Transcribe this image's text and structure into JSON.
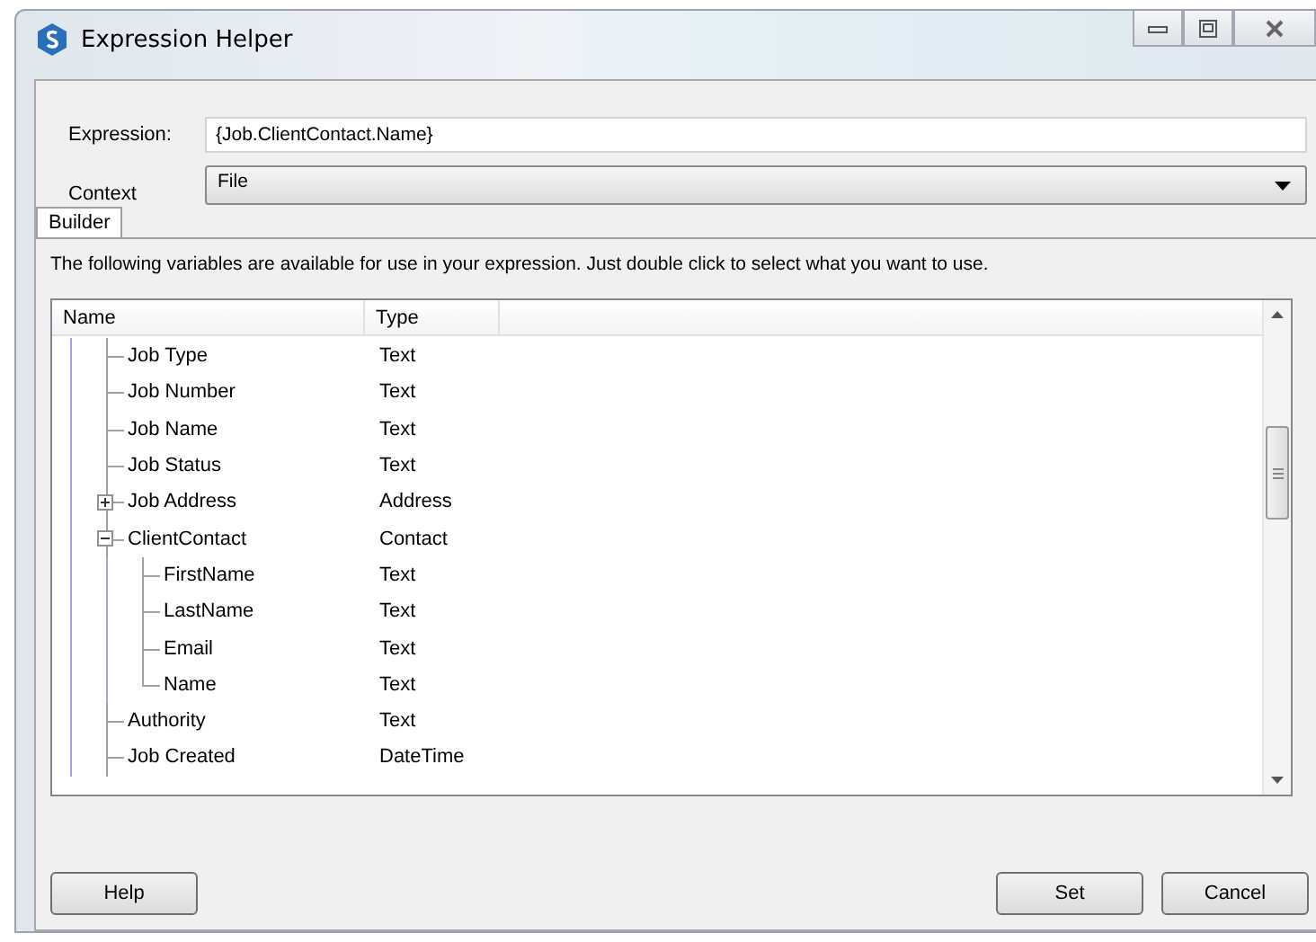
{
  "window": {
    "title": "Expression Helper"
  },
  "expression": {
    "label": "Expression:",
    "value": "{Job.ClientContact.Name}"
  },
  "context": {
    "label": "Context",
    "value": "File"
  },
  "tabs": [
    {
      "label": "Builder",
      "selected": true
    }
  ],
  "description": "The following variables are available for use in your expression. Just double click to select what you want to use.",
  "tree": {
    "columns": [
      "Name",
      "Type"
    ],
    "items": [
      {
        "name": "Job Type",
        "type": "Text"
      },
      {
        "name": "Job Number",
        "type": "Text"
      },
      {
        "name": "Job Name",
        "type": "Text"
      },
      {
        "name": "Job Status",
        "type": "Text"
      },
      {
        "name": "Job Address",
        "type": "Address",
        "expanded": false
      },
      {
        "name": "ClientContact",
        "type": "Contact",
        "expanded": true,
        "children": [
          {
            "name": "FirstName",
            "type": "Text"
          },
          {
            "name": "LastName",
            "type": "Text"
          },
          {
            "name": "Email",
            "type": "Text"
          },
          {
            "name": "Name",
            "type": "Text"
          }
        ]
      },
      {
        "name": "Authority",
        "type": "Text"
      },
      {
        "name": "Job Created",
        "type": "DateTime"
      }
    ]
  },
  "help_button": "Help",
  "buttons": [
    "Set",
    "Cancel"
  ]
}
